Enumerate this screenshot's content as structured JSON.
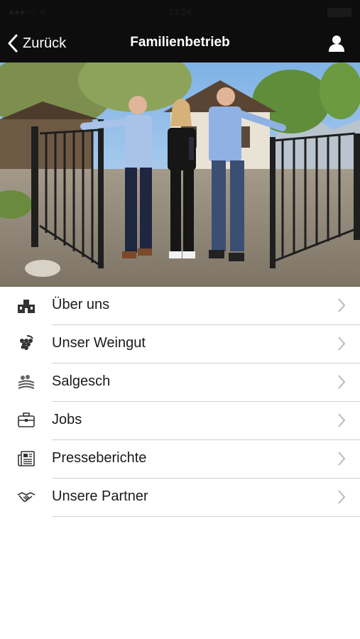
{
  "status_bar": {
    "carrier": "●●●○○ ≋",
    "time": "13:24"
  },
  "navbar": {
    "back_label": "Zurück",
    "title": "Familienbetrieb",
    "user_icon": "user-icon"
  },
  "hero": {
    "description": "photo-family-at-gate"
  },
  "menu": {
    "items": [
      {
        "label": "Über uns",
        "icon": "building-icon"
      },
      {
        "label": "Unser Weingut",
        "icon": "grapes-icon"
      },
      {
        "label": "Salgesch",
        "icon": "village-icon"
      },
      {
        "label": "Jobs",
        "icon": "briefcase-icon"
      },
      {
        "label": "Presseberichte",
        "icon": "newspaper-icon"
      },
      {
        "label": "Unsere Partner",
        "icon": "handshake-icon"
      }
    ]
  },
  "colors": {
    "bar": "#0d0d0d",
    "separator": "#cfcfcf",
    "chevron": "#b9b9b9",
    "text": "#1a1a1a"
  }
}
